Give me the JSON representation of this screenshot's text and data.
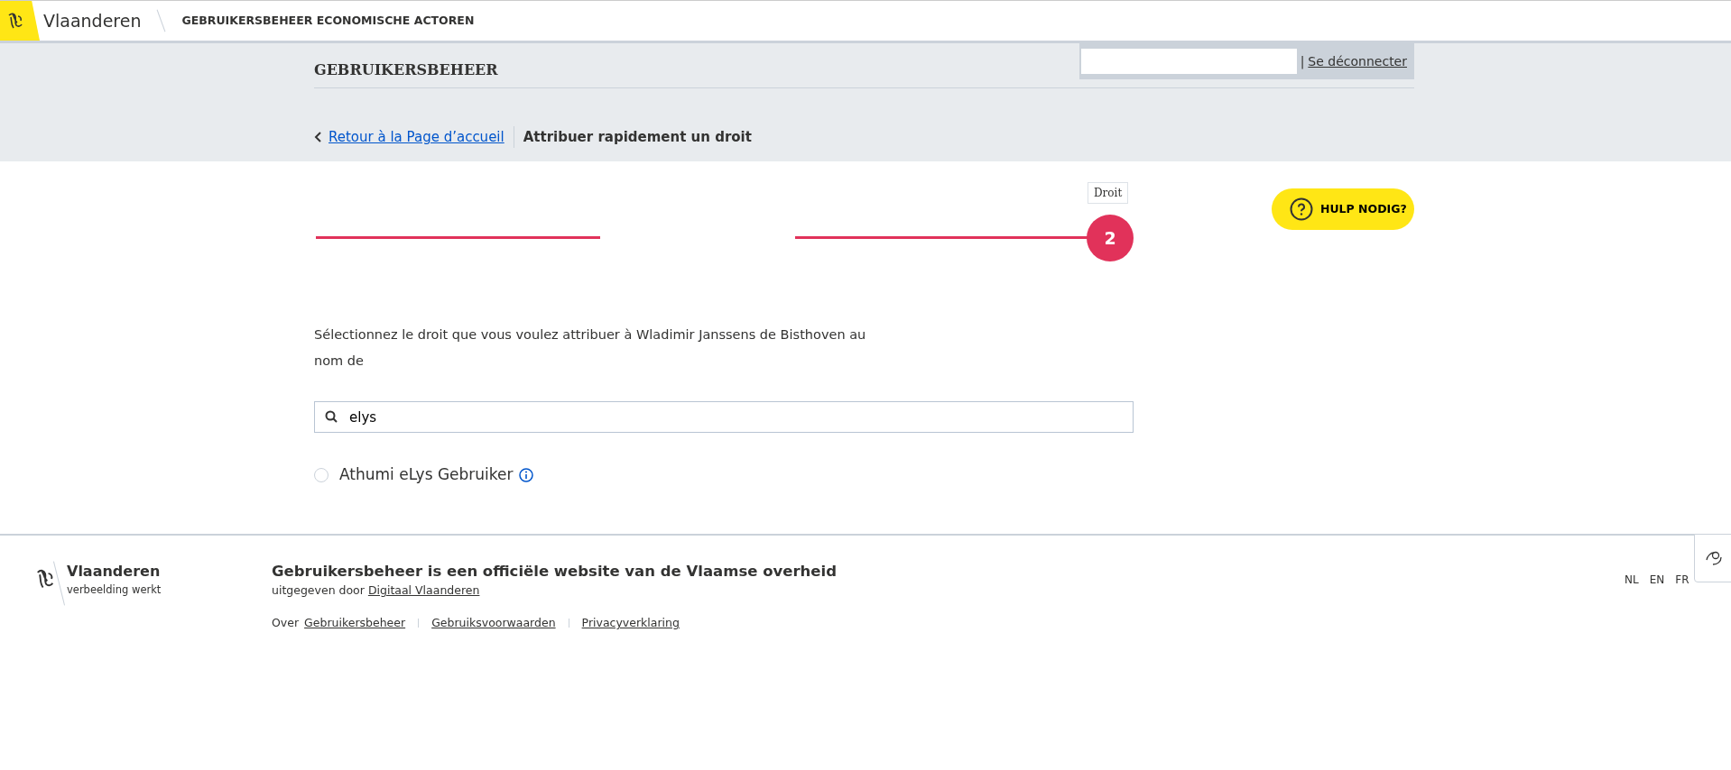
{
  "header": {
    "brand": "Vlaanderen",
    "app_title": "GEBRUIKERSBEHEER ECONOMISCHE ACTOREN"
  },
  "subheader": {
    "title": "GEBRUIKERSBEHEER",
    "separator": "|",
    "logout": "Se déconnecter"
  },
  "breadcrumb": {
    "back": "Retour à la Page d’accueil",
    "current": "Attribuer rapidement un droit"
  },
  "progress": {
    "step_number": "2",
    "step_label": "Droit"
  },
  "help_button": "HULP NODIG?",
  "instruction": "Sélectionnez le droit que vous voulez attribuer à Wladimir Janssens de Bisthoven au nom de",
  "search": {
    "value": "elys"
  },
  "options": [
    {
      "label": "Athumi eLys Gebruiker",
      "selected": false
    }
  ],
  "footer": {
    "brand": "Vlaanderen",
    "tagline": "verbeelding werkt",
    "title": "Gebruikersbeheer is een officiële website van de Vlaamse overheid",
    "published_by": "uitgegeven door",
    "publisher": "Digitaal Vlaanderen",
    "about": "Over",
    "links": [
      "Gebruikersbeheer",
      "Gebruiksvoorwaarden",
      "Privacyverklaring"
    ],
    "languages": [
      "NL",
      "EN",
      "FR"
    ]
  }
}
